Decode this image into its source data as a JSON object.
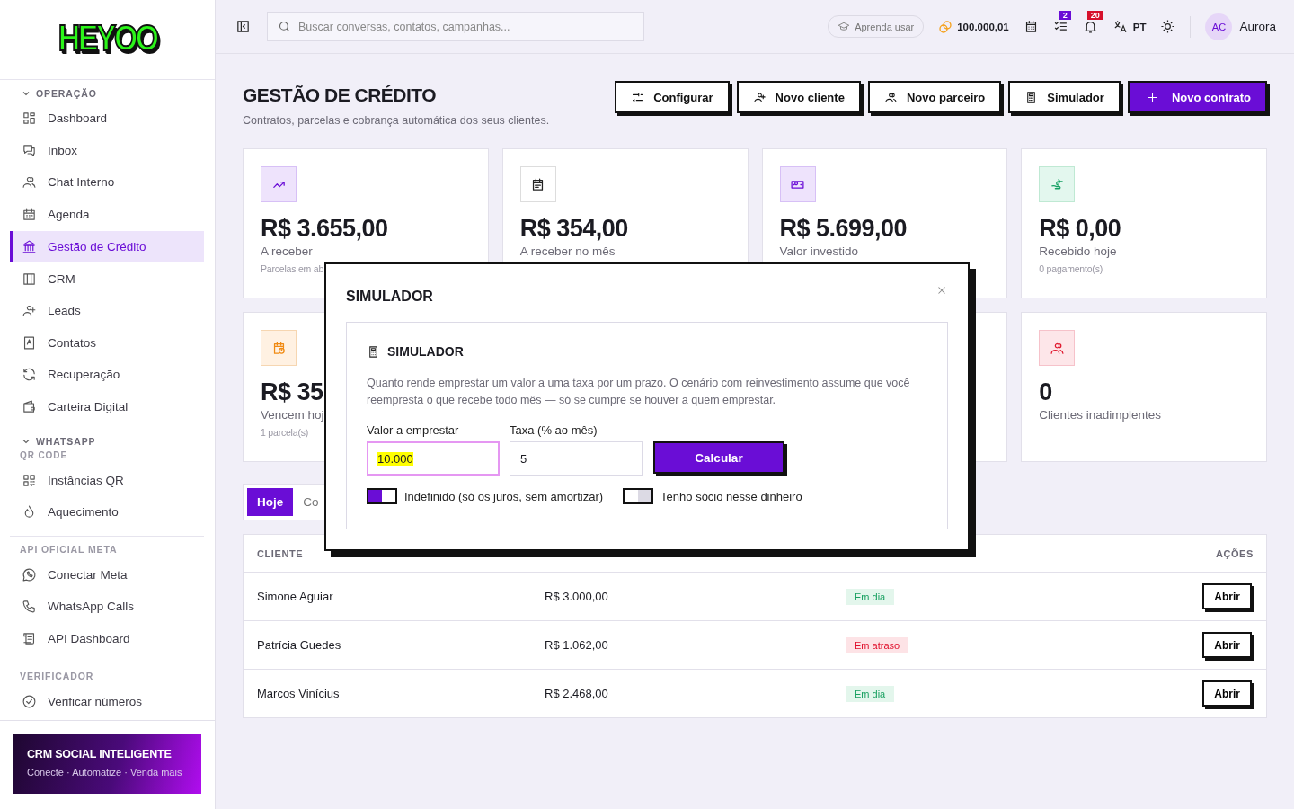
{
  "logo": "HEYOO",
  "sidebar": {
    "sections": [
      {
        "title": "OPERAÇÃO",
        "expanded": true,
        "items": [
          {
            "label": "Dashboard",
            "selected": false
          },
          {
            "label": "Inbox",
            "selected": false
          },
          {
            "label": "Chat Interno",
            "selected": false
          },
          {
            "label": "Agenda",
            "selected": false
          },
          {
            "label": "Gestão de Crédito",
            "selected": true
          },
          {
            "label": "CRM",
            "selected": false
          },
          {
            "label": "Leads",
            "selected": false
          },
          {
            "label": "Contatos",
            "selected": false
          },
          {
            "label": "Recuperação",
            "selected": false
          },
          {
            "label": "Carteira Digital",
            "selected": false
          }
        ]
      },
      {
        "title": "WHATSAPP",
        "expanded": true,
        "subtitle": "QR CODE",
        "items": [
          {
            "label": "Instâncias QR",
            "selected": false
          },
          {
            "label": "Aquecimento",
            "selected": false
          }
        ]
      },
      {
        "title": "API OFICIAL META",
        "items": [
          {
            "label": "Conectar Meta",
            "selected": false
          },
          {
            "label": "WhatsApp Calls",
            "selected": false
          },
          {
            "label": "API Dashboard",
            "selected": false
          }
        ]
      },
      {
        "title": "VERIFICADOR",
        "items": [
          {
            "label": "Verificar números",
            "selected": false
          }
        ]
      }
    ]
  },
  "promo": {
    "title": "CRM SOCIAL INTELIGENTE",
    "subtitle": "Conecte · Automatize · Venda mais"
  },
  "topbar": {
    "search_placeholder": "Buscar conversas, contatos, campanhas...",
    "learn": "Aprenda usar",
    "credits": "100.000,01",
    "tasks_badge": "2",
    "notifications_badge": "20",
    "language": "PT",
    "avatar": "AC",
    "user": "Aurora"
  },
  "page": {
    "title": "GESTÃO DE CRÉDITO",
    "subtitle": "Contratos, parcelas e cobrança automática dos seus clientes.",
    "actions": [
      {
        "label": "Configurar",
        "kind": "outline"
      },
      {
        "label": "Novo cliente",
        "kind": "outline"
      },
      {
        "label": "Novo parceiro",
        "kind": "outline"
      },
      {
        "label": "Simulador",
        "kind": "outline"
      },
      {
        "label": "Novo contrato",
        "kind": "primary"
      }
    ]
  },
  "stats": [
    {
      "value": "R$ 3.655,00",
      "label": "A receber",
      "note": "Parcelas em ab"
    },
    {
      "value": "R$ 354,00",
      "label": "A receber no mês"
    },
    {
      "value": "R$ 5.699,00",
      "label": "Valor investido"
    },
    {
      "value": "R$ 0,00",
      "label": "Recebido hoje",
      "note": "0 pagamento(s)"
    },
    {
      "value": "R$ 35",
      "label": "Vencem hoj",
      "note": "1 parcela(s)"
    },
    {
      "value": "0",
      "label": "Clientes inadimplentes"
    }
  ],
  "tabs": [
    {
      "label": "Hoje",
      "selected": true
    },
    {
      "label": "Co",
      "selected": false
    }
  ],
  "table": {
    "columns": [
      "CLIENTE",
      "AÇÕES"
    ],
    "rows": [
      {
        "client": "Simone Aguiar",
        "amount": "R$ 3.000,00",
        "status": "Em dia",
        "kind": "ok",
        "action": "Abrir"
      },
      {
        "client": "Patrícia Guedes",
        "amount": "R$ 1.062,00",
        "status": "Em atraso",
        "kind": "late",
        "action": "Abrir"
      },
      {
        "client": "Marcos Vinícius",
        "amount": "R$ 2.468,00",
        "status": "Em dia",
        "kind": "ok",
        "action": "Abrir"
      }
    ]
  },
  "modal": {
    "title": "SIMULADOR",
    "panel_title": "SIMULADOR",
    "description": "Quanto rende emprestar um valor a uma taxa por um prazo. O cenário com reinvestimento assume que você reempresta o que recebe todo mês — só se cumpre se houver a quem emprestar.",
    "fields": [
      {
        "label": "Valor a emprestar",
        "value": "10.000",
        "focused": true
      },
      {
        "label": "Taxa (% ao mês)",
        "value": "5",
        "focused": false
      }
    ],
    "button": "Calcular",
    "toggles": [
      {
        "label": "Indefinido (só os juros, sem amortizar)",
        "on": true
      },
      {
        "label": "Tenho sócio nesse dinheiro",
        "on": false
      }
    ]
  }
}
